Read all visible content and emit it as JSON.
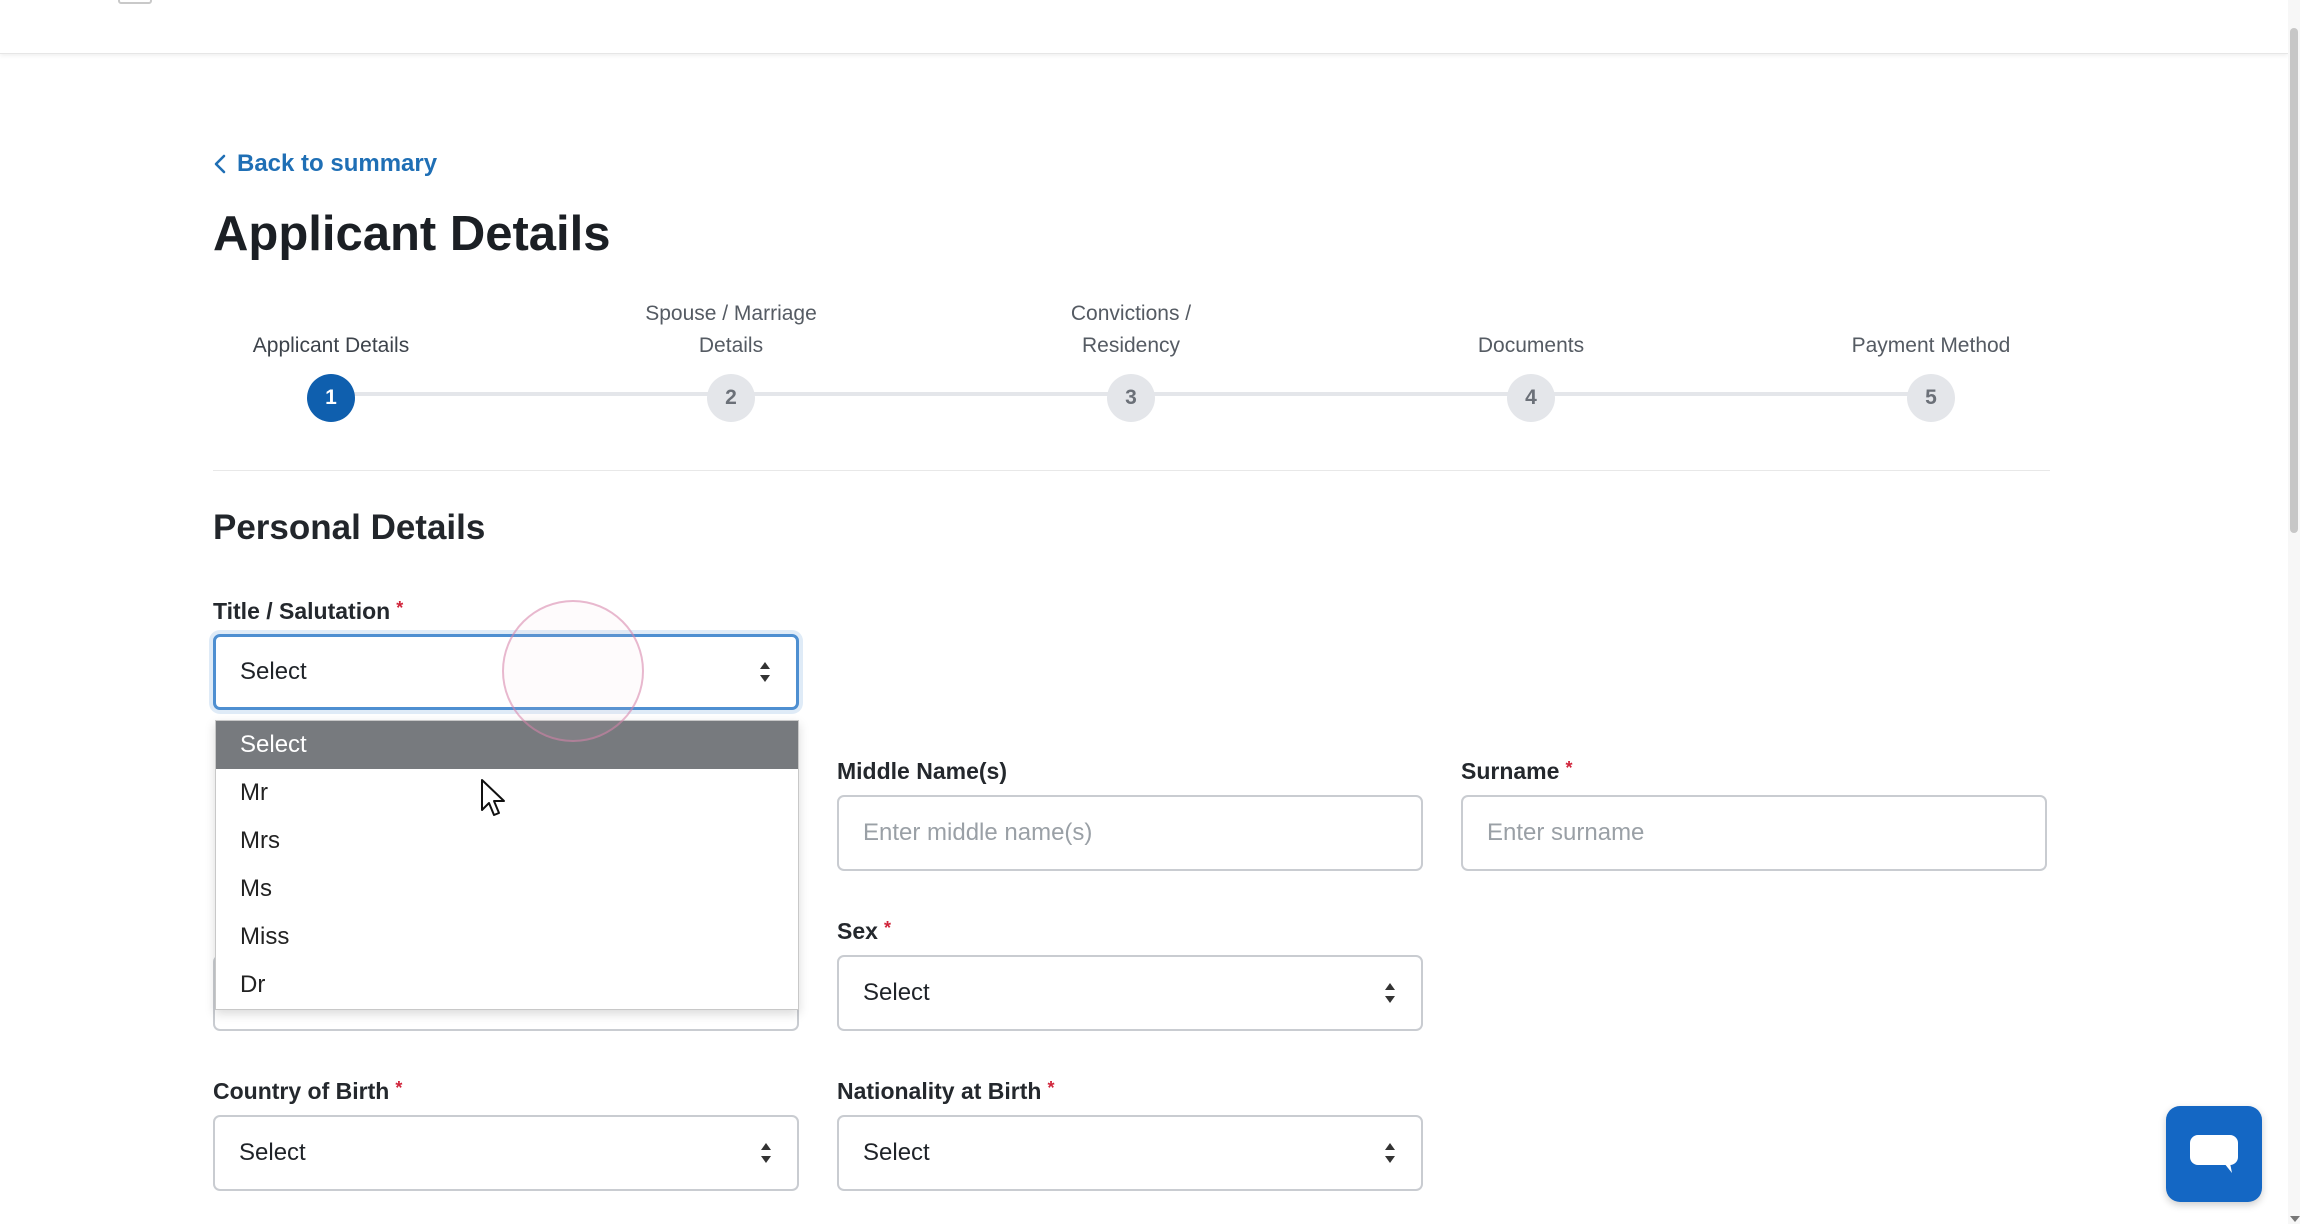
{
  "nav": {
    "back_label": "Back to summary"
  },
  "page_title": "Applicant Details",
  "stepper": {
    "steps": [
      {
        "number": "1",
        "label": "Applicant Details",
        "state": "active"
      },
      {
        "number": "2",
        "label": "Spouse / Marriage Details",
        "state": "pending"
      },
      {
        "number": "3",
        "label": "Convictions / Residency",
        "state": "pending"
      },
      {
        "number": "4",
        "label": "Documents",
        "state": "pending"
      },
      {
        "number": "5",
        "label": "Payment Method",
        "state": "pending"
      }
    ]
  },
  "section_title": "Personal Details",
  "form": {
    "title": {
      "label": "Title / Salutation",
      "required_mark": "*",
      "value": "Select"
    },
    "title_options": [
      "Select",
      "Mr",
      "Mrs",
      "Ms",
      "Miss",
      "Dr"
    ],
    "title_selected_index": 0,
    "middle_name": {
      "label": "Middle Name(s)",
      "placeholder": "Enter middle name(s)"
    },
    "surname": {
      "label": "Surname",
      "required_mark": "*",
      "placeholder": "Enter surname"
    },
    "sex": {
      "label": "Sex",
      "required_mark": "*",
      "value": "Select"
    },
    "country_of_birth": {
      "label": "Country of Birth",
      "required_mark": "*",
      "value": "Select"
    },
    "nationality_at_birth": {
      "label": "Nationality at Birth",
      "required_mark": "*",
      "value": "Select"
    }
  },
  "colors": {
    "primary": "#0f5fae",
    "link": "#1f6fb5",
    "required": "#d0243a",
    "chat_button": "#1467c4"
  },
  "icons": {
    "back": "chevron-left-icon",
    "select_arrows": "sort-updown-icon",
    "chat": "chat-bubble-icon"
  }
}
